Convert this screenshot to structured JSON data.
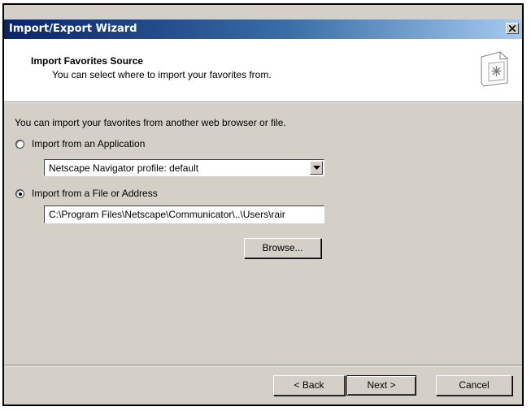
{
  "window": {
    "title": "Import/Export Wizard"
  },
  "icons": {
    "close": "close-icon",
    "wizard": "wizard-page-icon",
    "dropdown": "chevron-down-icon"
  },
  "header": {
    "title": "Import Favorites Source",
    "subtitle": "You can select where to import your favorites from."
  },
  "body": {
    "intro": "You can import your favorites from another web browser or file.",
    "option_app": {
      "label": "Import from an Application",
      "checked": false
    },
    "app_select": {
      "value": "Netscape Navigator profile: default"
    },
    "option_file": {
      "label": "Import from a File or Address",
      "checked": true
    },
    "file_input": {
      "value": "C:\\Program Files\\Netscape\\Communicator\\..\\Users\\rair"
    },
    "browse_label": "Browse..."
  },
  "footer": {
    "back_label": "< Back",
    "next_label": "Next >",
    "cancel_label": "Cancel"
  },
  "colors": {
    "title_start": "#0a246a",
    "title_end": "#a6caf0",
    "dialog_bg": "#d4d0c8"
  }
}
